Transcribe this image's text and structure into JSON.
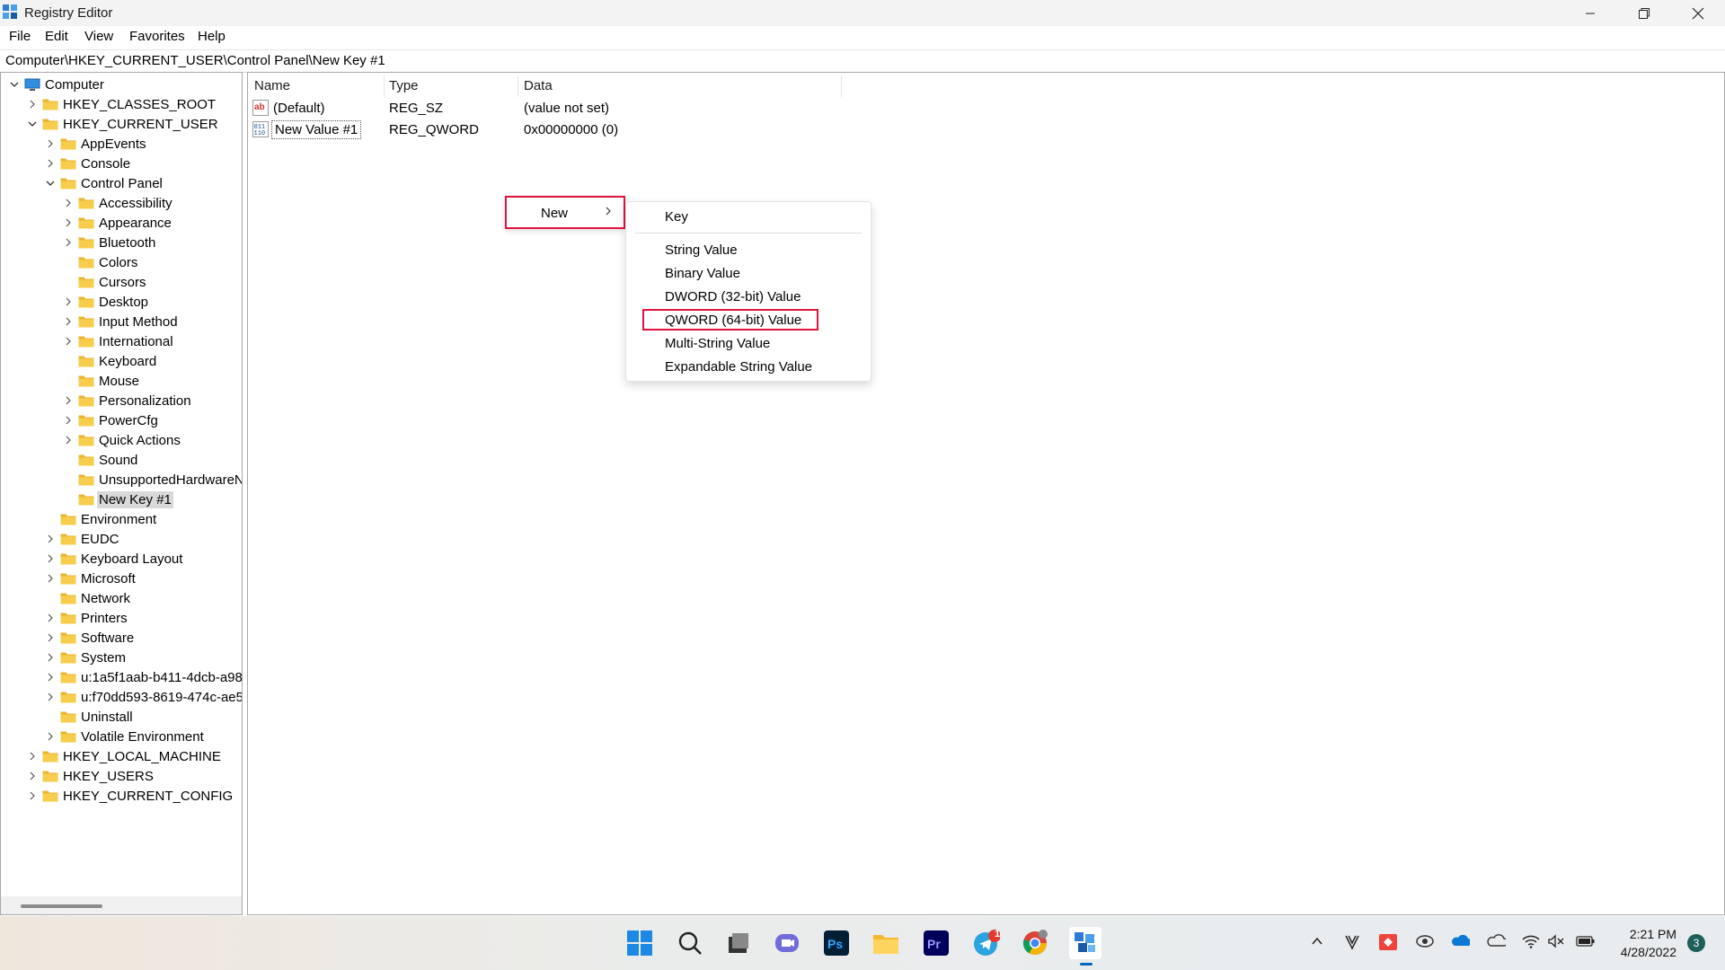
{
  "window": {
    "title": "Registry Editor"
  },
  "menu": [
    "File",
    "Edit",
    "View",
    "Favorites",
    "Help"
  ],
  "address": "Computer\\HKEY_CURRENT_USER\\Control Panel\\New Key #1",
  "tree": [
    {
      "label": "Computer",
      "level": 0,
      "state": "expanded",
      "icon": "computer-icon"
    },
    {
      "label": "HKEY_CLASSES_ROOT",
      "level": 1,
      "state": "collapsed"
    },
    {
      "label": "HKEY_CURRENT_USER",
      "level": 1,
      "state": "expanded"
    },
    {
      "label": "AppEvents",
      "level": 2,
      "state": "collapsed"
    },
    {
      "label": "Console",
      "level": 2,
      "state": "collapsed"
    },
    {
      "label": "Control Panel",
      "level": 2,
      "state": "expanded"
    },
    {
      "label": "Accessibility",
      "level": 3,
      "state": "collapsed"
    },
    {
      "label": "Appearance",
      "level": 3,
      "state": "collapsed"
    },
    {
      "label": "Bluetooth",
      "level": 3,
      "state": "collapsed"
    },
    {
      "label": "Colors",
      "level": 3,
      "state": "leaf"
    },
    {
      "label": "Cursors",
      "level": 3,
      "state": "leaf"
    },
    {
      "label": "Desktop",
      "level": 3,
      "state": "collapsed"
    },
    {
      "label": "Input Method",
      "level": 3,
      "state": "collapsed"
    },
    {
      "label": "International",
      "level": 3,
      "state": "collapsed"
    },
    {
      "label": "Keyboard",
      "level": 3,
      "state": "leaf"
    },
    {
      "label": "Mouse",
      "level": 3,
      "state": "leaf"
    },
    {
      "label": "Personalization",
      "level": 3,
      "state": "collapsed"
    },
    {
      "label": "PowerCfg",
      "level": 3,
      "state": "collapsed"
    },
    {
      "label": "Quick Actions",
      "level": 3,
      "state": "collapsed"
    },
    {
      "label": "Sound",
      "level": 3,
      "state": "leaf"
    },
    {
      "label": "UnsupportedHardwareN",
      "level": 3,
      "state": "leaf"
    },
    {
      "label": "New Key #1",
      "level": 3,
      "state": "leaf",
      "selected": true
    },
    {
      "label": "Environment",
      "level": 2,
      "state": "leaf"
    },
    {
      "label": "EUDC",
      "level": 2,
      "state": "collapsed"
    },
    {
      "label": "Keyboard Layout",
      "level": 2,
      "state": "collapsed"
    },
    {
      "label": "Microsoft",
      "level": 2,
      "state": "collapsed"
    },
    {
      "label": "Network",
      "level": 2,
      "state": "leaf"
    },
    {
      "label": "Printers",
      "level": 2,
      "state": "collapsed"
    },
    {
      "label": "Software",
      "level": 2,
      "state": "collapsed"
    },
    {
      "label": "System",
      "level": 2,
      "state": "collapsed"
    },
    {
      "label": "u:1a5f1aab-b411-4dcb-a98",
      "level": 2,
      "state": "collapsed"
    },
    {
      "label": "u:f70dd593-8619-474c-ae5",
      "level": 2,
      "state": "collapsed"
    },
    {
      "label": "Uninstall",
      "level": 2,
      "state": "leaf"
    },
    {
      "label": "Volatile Environment",
      "level": 2,
      "state": "collapsed"
    },
    {
      "label": "HKEY_LOCAL_MACHINE",
      "level": 1,
      "state": "collapsed"
    },
    {
      "label": "HKEY_USERS",
      "level": 1,
      "state": "collapsed"
    },
    {
      "label": "HKEY_CURRENT_CONFIG",
      "level": 1,
      "state": "collapsed"
    }
  ],
  "list": {
    "columns": [
      "Name",
      "Type",
      "Data"
    ],
    "rows": [
      {
        "name": "(Default)",
        "type": "REG_SZ",
        "data": "(value not set)",
        "icon": "string-value-icon"
      },
      {
        "name": "New Value #1",
        "type": "REG_QWORD",
        "data": "0x00000000 (0)",
        "icon": "binary-value-icon"
      }
    ]
  },
  "context_menu": {
    "new_label": "New",
    "submenu": [
      "Key",
      "String Value",
      "Binary Value",
      "DWORD (32-bit) Value",
      "QWORD (64-bit) Value",
      "Multi-String Value",
      "Expandable String Value"
    ]
  },
  "taskbar": {
    "telegram_badge": "1",
    "time": "2:21 PM",
    "date": "4/28/2022",
    "notifications": "3"
  },
  "colors": {
    "highlight": "#e0143c",
    "folder": "#f4c542",
    "accent": "#0067c0"
  }
}
